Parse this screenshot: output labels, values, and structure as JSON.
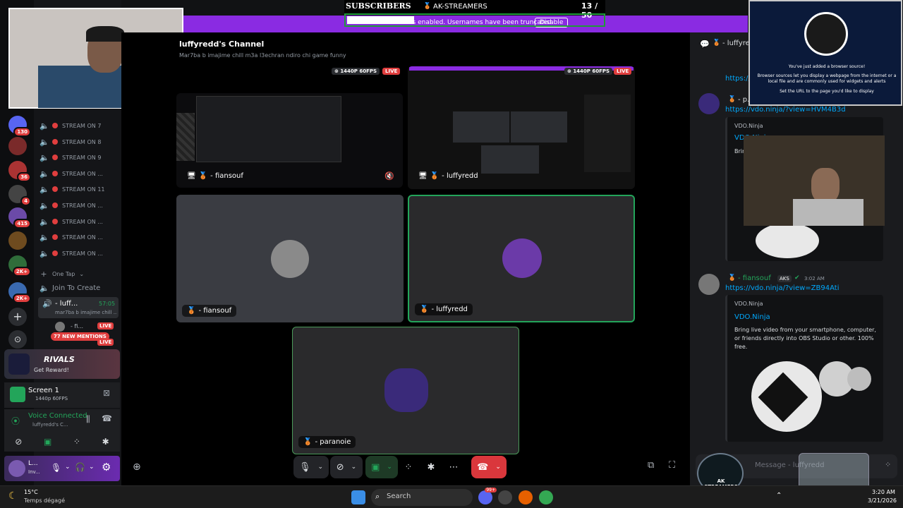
{
  "overlay": {
    "subscribers_label": "SUBSCRIBERS",
    "streamer_label": "AK-STREAMERS",
    "sub_count": "13 / 50",
    "sub_progress": 0.26,
    "streamer_mode_text": "Streamer Mode is enabled. Usernames have been truncated.",
    "disable_label": "Disable"
  },
  "obs": {
    "line1": "You've just added a browser source!",
    "line2": "Browser sources let you display a webpage from the internet or a local file and are commonly used for widgets and alerts",
    "line3": "Set the URL to the page you'd like to display"
  },
  "servers": {
    "badges": [
      "130",
      "36",
      "4",
      "415",
      "2K+",
      "2K+"
    ]
  },
  "channels": {
    "streams": [
      "STREAM ON 7",
      "STREAM ON 8",
      "STREAM ON 9",
      "STREAM ON ...",
      "STREAM ON 11",
      "STREAM ON ...",
      "STREAM ON ...",
      "STREAM ON ...",
      "STREAM ON ..."
    ],
    "one_tap": "One Tap",
    "join_to_create": "Join To Create",
    "active_channel": "- luff...",
    "active_time": "57:05",
    "active_sub": "mar7ba b imajime chill ...",
    "user_fi": "- fi...",
    "live_label": "LIVE",
    "mentions": "77 NEW MENTIONS"
  },
  "promo": {
    "brand": "RIVALS",
    "cta": "Get Reward!"
  },
  "screen_panel": {
    "title": "Screen 1",
    "quality": "1440p 60FPS"
  },
  "voice_panel": {
    "status": "Voice Connected",
    "channel": "luffyredd's C..."
  },
  "user_panel": {
    "name": "L...",
    "status": "Inv..."
  },
  "main": {
    "channel_title": "luffyredd's Channel",
    "channel_sub": "Mar7ba b imajime chill m3a l3echran ndiro chi game funny",
    "quality_badge": "1440P 60FPS",
    "live_label": "LIVE",
    "tiles": [
      {
        "name": "- fiansouf"
      },
      {
        "name": "- luffyredd"
      },
      {
        "name": "- fiansouf"
      },
      {
        "name": "- luffyredd"
      },
      {
        "name": "- paranoie"
      }
    ]
  },
  "chat": {
    "header_name": "- luffyred",
    "link_top": "https://",
    "user_top": "- p...",
    "link1": "https://vdo.ninja/?view=HVM4B3d",
    "embed1_site": "VDO.Ninja",
    "embed1_title": "VDO.Ninja",
    "embed1_desc_partial": "Bring",
    "msg2_user": "- fiansouf",
    "msg2_tag": "AKS",
    "msg2_time": "3:02 AM",
    "link2": "https://vdo.ninja/?view=ZB94Ati",
    "embed2_site": "VDO.Ninja",
    "embed2_title": "VDO.Ninja",
    "embed2_desc": "Bring live video from your smartphone, computer, or friends directly into OBS Studio or other. 100% free.",
    "input_placeholder": "Message - luffyredd",
    "logo_text": "AK STREAMERS"
  },
  "taskbar": {
    "temp": "15°C",
    "weather": "Temps dégagé",
    "search": "Search",
    "time": "3:20 AM",
    "date": "3/21/2026",
    "discord_badge": "99+"
  },
  "colors": {
    "accent_purple": "#8a2be2",
    "live_red": "#e03e3e",
    "speaking_green": "#23a55a",
    "link_blue": "#00a8fc"
  }
}
